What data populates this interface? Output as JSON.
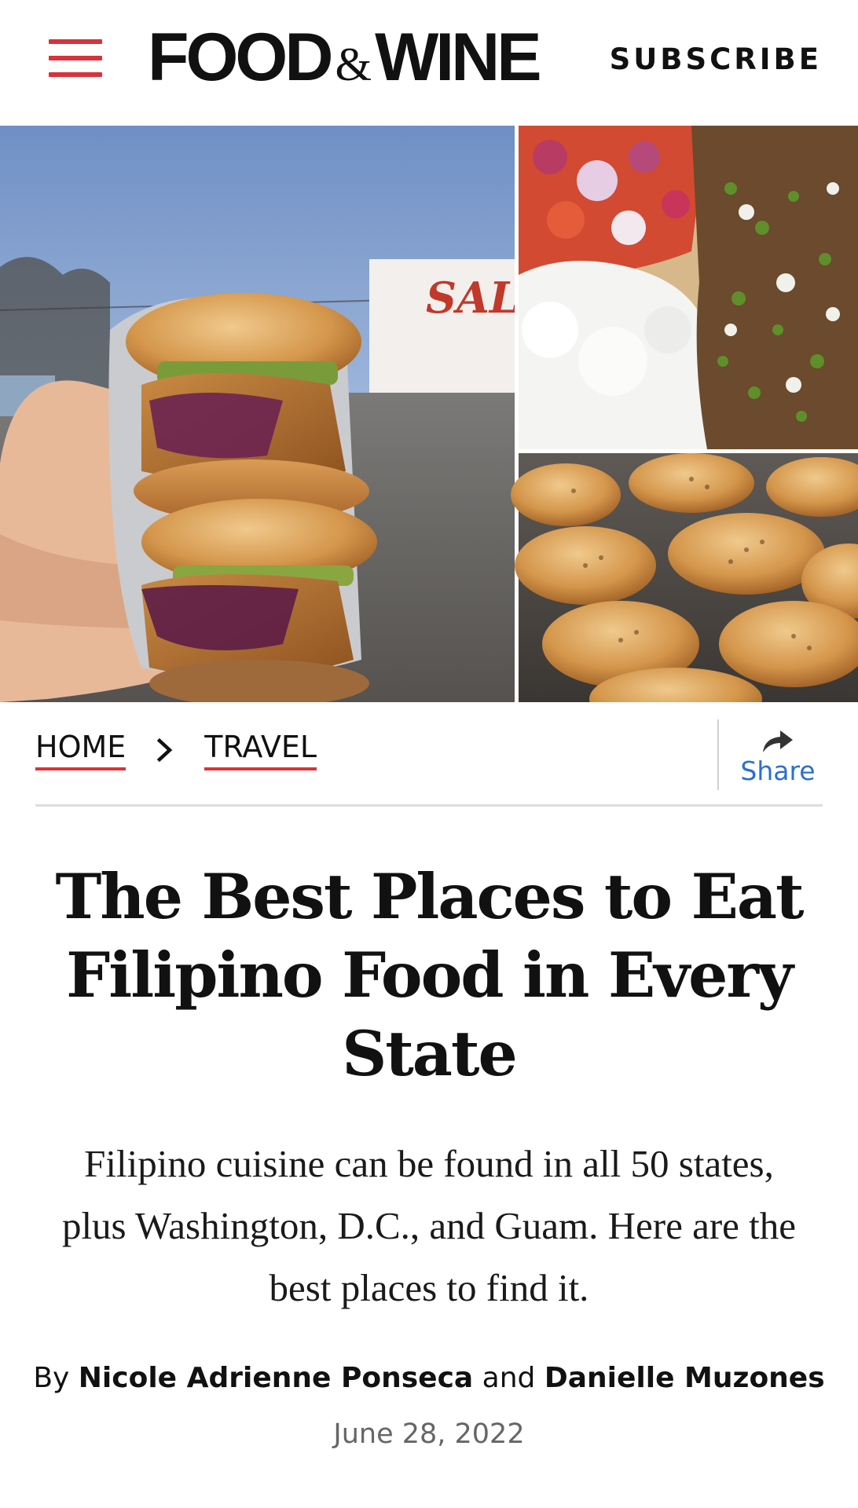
{
  "header": {
    "menu_icon": "hamburger-menu-icon",
    "logo": {
      "left": "FOOD",
      "amp": "&",
      "right": "WINE"
    },
    "subscribe_label": "SUBSCRIBE"
  },
  "hero": {
    "truck_sign_text": "SAL",
    "panels": [
      "hand holding two fried chicken sandwiches",
      "rice with tomato salsa and chopped greens",
      "sesame-topped buns on a baking tray"
    ]
  },
  "breadcrumb": {
    "items": [
      "HOME",
      "TRAVEL"
    ],
    "separator_icon": "chevron-right-icon"
  },
  "share": {
    "icon": "share-arrow-icon",
    "label": "Share"
  },
  "article": {
    "title": "The Best Places to Eat Filipino Food in Every State",
    "dek": "Filipino cuisine can be found in all 50 states, plus Washington, D.C., and Guam. Here are the best places to find it.",
    "byline": {
      "prefix": "By",
      "authors": [
        "Nicole Adrienne Ponseca",
        "Danielle Muzones"
      ],
      "conjunction": "and"
    },
    "date": "June 28, 2022"
  },
  "colors": {
    "accent_red": "#d7333a",
    "link_blue": "#2e6fcf",
    "text": "#111111",
    "muted": "#666666"
  }
}
